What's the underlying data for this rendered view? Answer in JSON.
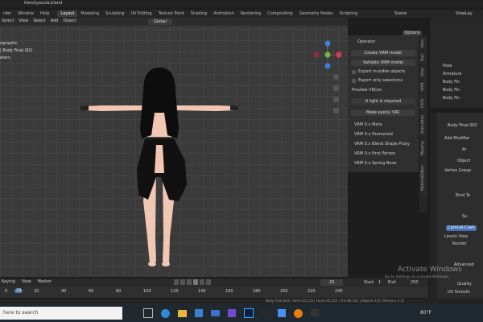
{
  "window": {
    "title": "tfarol\\yasuta.blend"
  },
  "menu": [
    "rder",
    "Window",
    "Help"
  ],
  "workspaces": [
    "Layout",
    "Modeling",
    "Sculpting",
    "UV Editing",
    "Texture Paint",
    "Shading",
    "Animation",
    "Rendering",
    "Compositing",
    "Geometry Nodes",
    "Scripting"
  ],
  "active_workspace": "Layout",
  "scene": {
    "label": "Scene",
    "viewlayer": "ViewLay"
  },
  "viewport_header": {
    "items": [
      "Select",
      "View",
      "Select",
      "Add",
      "Object"
    ],
    "transform": "Global",
    "options": "Options"
  },
  "overlay_text": [
    "ographic",
    "| Body Final.002",
    "eters"
  ],
  "vrm_panel": {
    "title": "Operator",
    "buttons": [
      "Create VRM model",
      "Validate VRM model"
    ],
    "checks": [
      "Export invisible objects",
      "Export only selections"
    ],
    "preview_label": "Preview VRCon",
    "light_notice": "A light is required",
    "make_button": "Make eye(s) VRC",
    "sections": [
      "VRM 0.x Meta",
      "VRM 0.x Humanoid",
      "VRM 0.x Blend Shape Proxy",
      "VRM 0.x First Person",
      "VRM 0.x Spring Bone"
    ]
  },
  "side_tabs": [
    "Item",
    "Tool",
    "View",
    "VRM",
    "CATS",
    "Animation",
    "Mixamo",
    "MaterialEditor"
  ],
  "outliner": {
    "items": [
      "Pose",
      "Armature",
      "Body Fin",
      "Body Fin",
      "Body Fin"
    ]
  },
  "properties": {
    "object_name": "Body Final.002",
    "add_modifier": "Add Modifier",
    "modifier1": "Ar",
    "fields": [
      "Object",
      "Vertex Group",
      "Bind To"
    ],
    "modifier2": "Su",
    "catmull": "Catmull-Clark",
    "levels": [
      "Levels View",
      "Render"
    ],
    "advanced": "Advanced",
    "quality": "Quality",
    "uv_smooth": "UV Smooth"
  },
  "timeline": {
    "menu": [
      "Keying",
      "View",
      "Marker"
    ],
    "frame": "29",
    "start_label": "Start",
    "start": "1",
    "end_label": "End",
    "end": "250",
    "ticks": [
      "0",
      "20",
      "40",
      "60",
      "80",
      "100",
      "120",
      "140",
      "160",
      "180",
      "200",
      "220",
      "240"
    ],
    "current": "29"
  },
  "status": {
    "text": "Body Final.002 | Verts:45,213 | Faces:45,152 | Tris:88,322 | Objects:1/3 | Memory 3.12"
  },
  "watermark": {
    "line1": "Activate Windows",
    "line2": "Go to Settings to activate Windows."
  },
  "taskbar": {
    "search_placeholder": "here to search",
    "temp": "80°F",
    "colors": {
      "bg": "#202830",
      "accent": "#4a7fd4"
    }
  },
  "colors": {
    "viewport": "#3d3d3d",
    "panel": "#303030",
    "grid": "#444444",
    "accent": "#4772b3",
    "skin": "#f1c6b3"
  }
}
